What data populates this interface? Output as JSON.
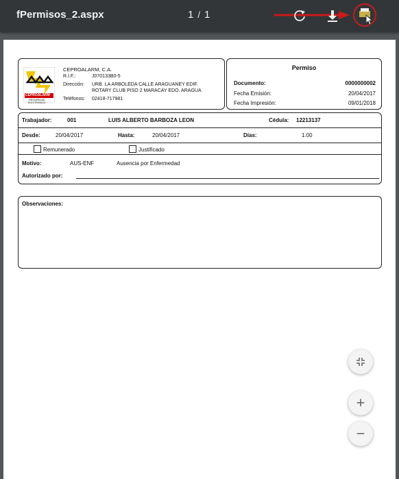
{
  "toolbar": {
    "title": "fPermisos_2.aspx",
    "current_page": "1",
    "page_sep": "/",
    "total_pages": "1",
    "icons": [
      "rotate-icon",
      "download-icon",
      "print-icon"
    ],
    "arrow_color": "#cc1a1a"
  },
  "company": {
    "name": "CEPROALARM, C.A.",
    "rif_label": "R.I.F.:",
    "rif_value": "J070133B0-5",
    "address_label": "Dirección:",
    "address_line1": "URB. LA ARBOLEDA CALLE ARAGUANEY EDIF.",
    "address_line2": "ROTARY CLUB PISO 2 MARACAY EDO. ARAGUA",
    "phone_label": "Teléfonos:",
    "phone_value": "02418-717981",
    "logo_text": "CEPROALARM",
    "logo_subtext1": "SEGURIDAD",
    "logo_subtext2": "ELECTRONICA"
  },
  "permit": {
    "heading": "Permiso",
    "document_label": "Documento:",
    "document_value": "0000000002",
    "issue_label": "Fecha Emisión:",
    "issue_value": "20/04/2017",
    "print_label": "Fecha Impresión:",
    "print_value": "09/01/2018"
  },
  "details": {
    "worker_label": "Trabajador:",
    "worker_code": "001",
    "worker_name": "LUIS ALBERTO BARBOZA LEON",
    "id_label": "Cédula:",
    "id_value": "12213137",
    "from_label": "Desde:",
    "from_value": "20/04/2017",
    "to_label": "Hasta:",
    "to_value": "20/04/2017",
    "days_label": "Días:",
    "days_value": "1.00",
    "paid_label": "Remunerado",
    "justified_label": "Justificado",
    "reason_label": "Motivo:",
    "reason_code": "AUS-ENF",
    "reason_desc": "Ausencia por Enfermedad",
    "authorized_label": "Autorizado por:"
  },
  "observations": {
    "label": "Observaciones:"
  },
  "zoom_controls": [
    "fit-page-icon",
    "zoom-in-icon",
    "zoom-out-icon"
  ]
}
